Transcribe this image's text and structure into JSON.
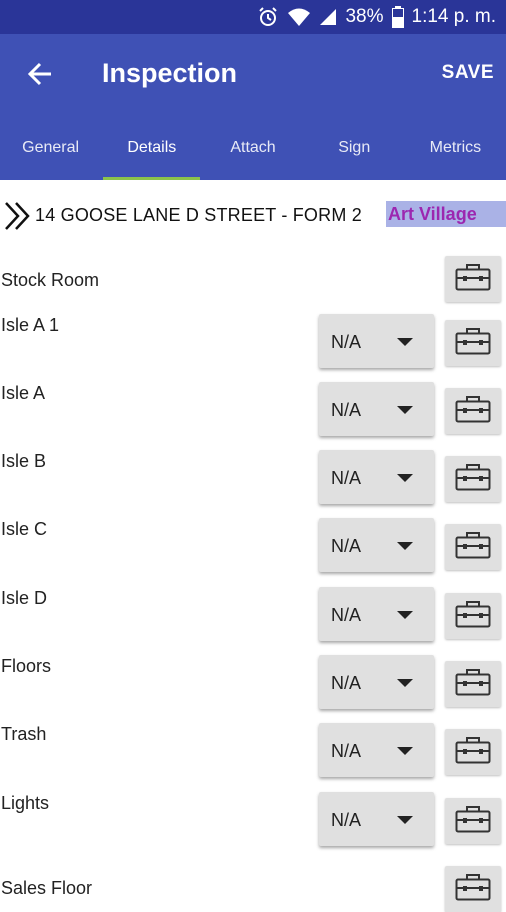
{
  "status_bar": {
    "battery": "38%",
    "time": "1:14 p. m."
  },
  "app_bar": {
    "title": "Inspection",
    "save_label": "SAVE"
  },
  "tabs": [
    {
      "label": "General",
      "active": false
    },
    {
      "label": "Details",
      "active": true
    },
    {
      "label": "Attach",
      "active": false
    },
    {
      "label": "Sign",
      "active": false
    },
    {
      "label": "Metrics",
      "active": false
    }
  ],
  "form": {
    "title": "14 GOOSE LANE D STREET - FORM 2",
    "location": "Art Village"
  },
  "items": [
    {
      "label": "Stock Room",
      "value": null
    },
    {
      "label": "Isle A 1",
      "value": "N/A"
    },
    {
      "label": "Isle A",
      "value": "N/A"
    },
    {
      "label": "Isle B",
      "value": "N/A"
    },
    {
      "label": "Isle C",
      "value": "N/A"
    },
    {
      "label": "Isle D",
      "value": "N/A"
    },
    {
      "label": "Floors",
      "value": "N/A"
    },
    {
      "label": "Trash",
      "value": "N/A"
    },
    {
      "label": "Lights",
      "value": "N/A"
    },
    {
      "label": "Sales Floor",
      "value": null
    }
  ],
  "colors": {
    "status_bar": "#2a3598",
    "app_bar": "#3f51b5",
    "tab_indicator": "#8bc34a",
    "location_bg": "#aab2e6",
    "location_text": "#9c27b0"
  }
}
